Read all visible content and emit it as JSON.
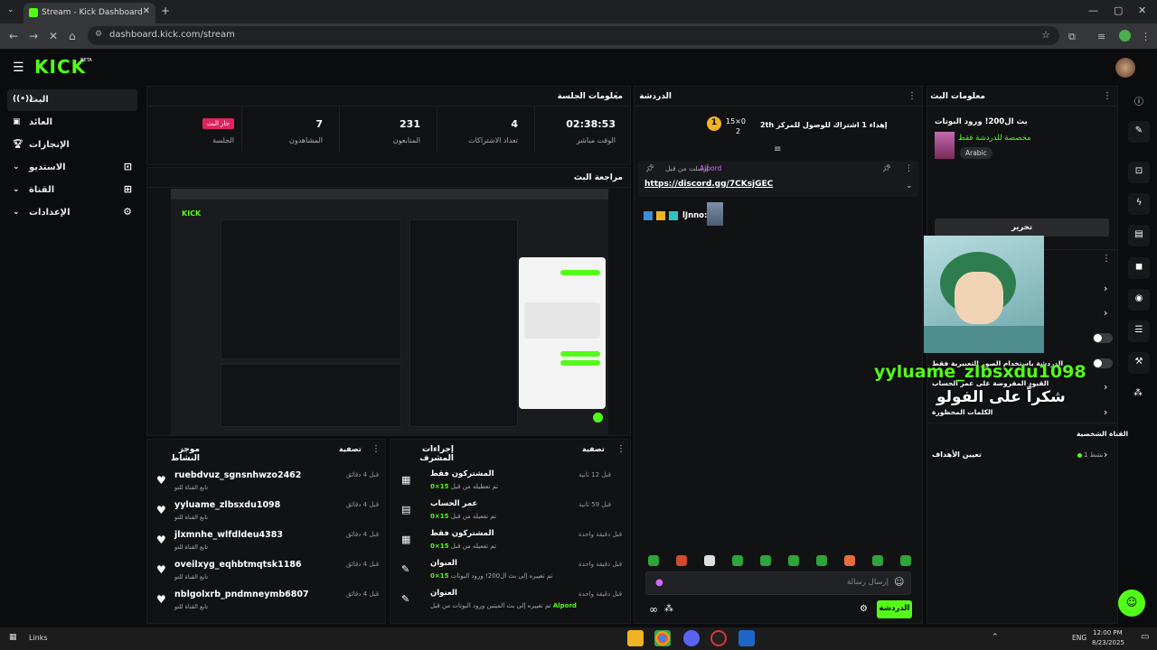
{
  "browser": {
    "tab_title": "Stream - Kick Dashboard",
    "url": "dashboard.kick.com/stream"
  },
  "header": {
    "logo": "KICK",
    "beta": "BETA"
  },
  "sidebar": {
    "items": [
      {
        "label": "البث",
        "icon": "live-icon"
      },
      {
        "label": "العائد",
        "icon": "revenue-icon"
      },
      {
        "label": "الإنجازات",
        "icon": "trophy-icon"
      },
      {
        "label": "الاستديو",
        "icon": "studio-icon"
      },
      {
        "label": "القناة",
        "icon": "channel-icon"
      },
      {
        "label": "الإعدادات",
        "icon": "gear-icon"
      }
    ]
  },
  "session": {
    "title": "معلومات الجلسة",
    "live_badge": "جار البث",
    "session_label": "الجلسة",
    "stats": [
      {
        "value": "02:38:53",
        "label": "الوقت مباشر"
      },
      {
        "value": "4",
        "label": "تعداد الاشتراكات"
      },
      {
        "value": "231",
        "label": "المتابعون"
      },
      {
        "value": "7",
        "label": "المشاهدون"
      }
    ]
  },
  "preview": {
    "title": "مراجعة البث"
  },
  "activity": {
    "title": "موجز النشاط",
    "filter": "تصفية",
    "rows": [
      {
        "name": "ruebdvuz_sgnsnhwzo2462",
        "sub": "تابع القناة للتو",
        "time": "قبل 4 دقائق"
      },
      {
        "name": "yyluame_zlbsxdu1098",
        "sub": "تابع القناة للتو",
        "time": "قبل 4 دقائق"
      },
      {
        "name": "jlxmnhe_wlfdldeu4383",
        "sub": "تابع القناة للتو",
        "time": "قبل 4 دقائق"
      },
      {
        "name": "oveilxyg_eqhbtmqtsk1186",
        "sub": "تابع القناة للتو",
        "time": "قبل 4 دقائق"
      },
      {
        "name": "nblgolxrb_pndmneymb6807",
        "sub": "تابع القناة للتو",
        "time": "قبل 4 دقائق"
      }
    ]
  },
  "mod": {
    "title": "إجراءات المشرف",
    "filter": "تصفية",
    "rows": [
      {
        "title": "المشتركون فقط",
        "sub_pre": "15×0",
        "sub": "تم تعطيله من قبل",
        "time": "قبل 12 ثانية"
      },
      {
        "title": "عمر الحساب",
        "sub_pre": "15×0",
        "sub": "تم تفعيله من قبل",
        "time": "قبل 59 ثانية"
      },
      {
        "title": "المشتركون فقط",
        "sub_pre": "15×0",
        "sub": "تم تفعيله من قبل",
        "time": "قبل دقيقة واحدة"
      },
      {
        "title": "العنوان",
        "sub_pre": "15×0",
        "sub": "تم تغييره إلى بث ال200! ورود البوتات",
        "time": "قبل دقيقة واحدة"
      },
      {
        "title": "العنوان",
        "sub_pre": "Alpord",
        "sub": "تم تغييره إلى بث الميتين ورود البوتات من قبل",
        "time": "قبل دقيقة واحدة"
      }
    ]
  },
  "chat": {
    "title": "الدردشة",
    "goal": "إهداء 1 اشتراك للوصول للمركز 2",
    "goal_suffix": "th",
    "goal_rank": "1",
    "goal_user": "15×0",
    "goal_count": "2",
    "pinned_by": "أرسلت من قبل",
    "pinned_user": "Alpord",
    "pinned_link": "https://discord.gg/7CKsjGEC",
    "msg_user": "lJnno:",
    "input_placeholder": "إرسال رسالة",
    "send_label": "الدردشة"
  },
  "stream_info": {
    "title": "معلومات البث",
    "stream_title": "بث ال200! ورود البوتات",
    "category": "مخصصة للدردشة فقط",
    "language": "Arabic",
    "edit_label": "تحرير"
  },
  "chat_settings": {
    "emotes_only": "الدردشة باستخدام الصور التعبيرية فقط",
    "account_age": "القيود المفروضة على عمر الحساب",
    "banned_words": "الكلمات المحظورة"
  },
  "channel": {
    "label": "القناة الشخصية",
    "goals_label": "تعيين الأهداف",
    "goals_status": "نشط 1"
  },
  "overlay": {
    "username": "yyluame_zlbsxdu1098",
    "thanks": "شكراً على الفولو"
  },
  "taskbar": {
    "links": "Links",
    "lang": "ENG",
    "time": "12:00 PM",
    "date": "8/23/2025"
  },
  "colors": {
    "accent": "#53fc18",
    "live": "#e0245e"
  }
}
